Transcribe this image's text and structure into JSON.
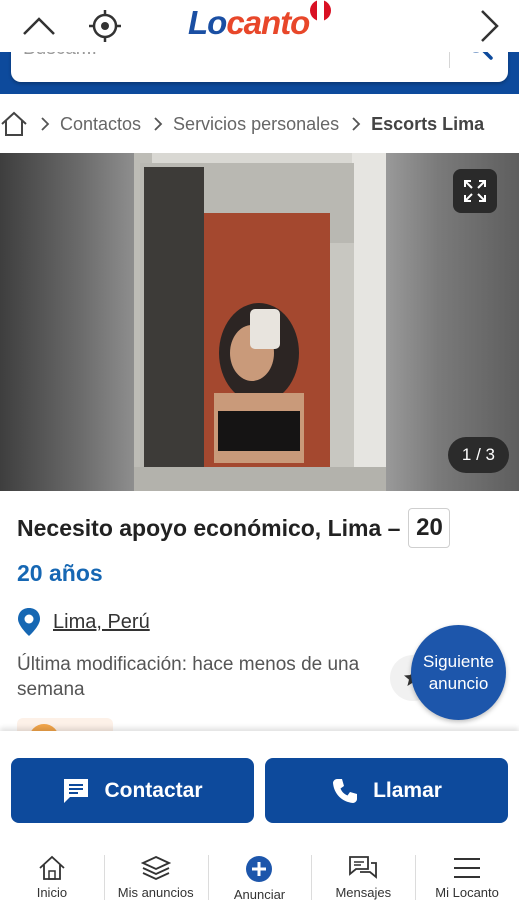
{
  "header": {
    "logo": {
      "part1": "Lo",
      "part2": "canto"
    },
    "icons": {
      "collapse": "chevron-up-icon",
      "locate": "crosshair-icon",
      "next": "chevron-right-icon",
      "flag": "peru-flag-icon"
    }
  },
  "search": {
    "placeholder": "Buscar..."
  },
  "breadcrumb": {
    "home_icon": "home-icon",
    "items": [
      "Contactos",
      "Servicios personales"
    ],
    "current": "Escorts Lima"
  },
  "gallery": {
    "counter": "1 / 3",
    "expand_icon": "expand-icon"
  },
  "listing": {
    "title": "Necesito apoyo económico, Lima –",
    "age_badge": "20",
    "age": "20 años",
    "location": "Lima, Perú",
    "modified": "Última modificación: hace menos de una semana"
  },
  "next_ad": {
    "label": "Siguiente anuncio"
  },
  "actions": {
    "contact": "Contactar",
    "call": "Llamar"
  },
  "bottom_nav": [
    {
      "label": "Inicio",
      "icon": "home-icon"
    },
    {
      "label": "Mis anuncios",
      "icon": "stack-icon"
    },
    {
      "label": "Anunciar",
      "icon": "plus-circle-icon"
    },
    {
      "label": "Mensajes",
      "icon": "chat-icon"
    },
    {
      "label": "Mi Locanto",
      "icon": "menu-icon"
    }
  ],
  "colors": {
    "brand_blue": "#0d4a9c",
    "link_blue": "#1667b3",
    "logo_red": "#e8472a",
    "next_button": "#1d56ab"
  }
}
